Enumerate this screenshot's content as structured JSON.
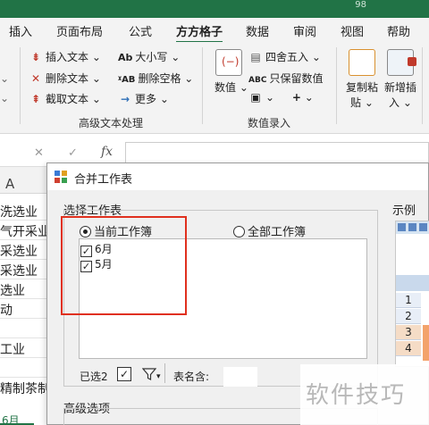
{
  "titlebar": {
    "controls_text": "98"
  },
  "ribbon_tabs": [
    "插入",
    "页面布局",
    "公式",
    "方方格子",
    "数据",
    "审阅",
    "视图",
    "帮助"
  ],
  "active_tab": "方方格子",
  "ribbon": {
    "advanced_text": {
      "insert_text": "插入文本",
      "delete_text": "删除文本",
      "extract_text": "截取文本",
      "case": "大小写",
      "remove_space": "删除空格",
      "more": "更多",
      "group_label": "高级文本处理"
    },
    "number_entry": {
      "number_btn": "数值",
      "round": "四舍五入",
      "keep_numbers": "只保留数值",
      "group_label": "数值录入"
    },
    "right_buttons": {
      "copy_paste_line1": "复制粘",
      "copy_paste_line2": "贴",
      "add_insert_line1": "新增插",
      "add_insert_line2": "入"
    }
  },
  "formula_bar": {
    "fx": "fx"
  },
  "sheet": {
    "column": "A",
    "cells": [
      "洗选业",
      "气开采业",
      "采选业",
      "采选业",
      "选业",
      "动",
      "",
      "工业",
      "",
      "精制茶制"
    ],
    "tab": "6月"
  },
  "dialog": {
    "title": "合并工作表",
    "select_section": "选择工作表",
    "example_label": "示例",
    "radio_current": "当前工作簿",
    "radio_all": "全部工作簿",
    "sheets": [
      {
        "name": "6月",
        "checked": true
      },
      {
        "name": "5月",
        "checked": true
      }
    ],
    "selected_label": "已选2",
    "filter_label": "表名含:",
    "advanced_section": "高级选项"
  },
  "example": {
    "rows": [
      "1",
      "2",
      "3",
      "4"
    ]
  },
  "watermark": "软件技巧",
  "colors": {
    "accent": "#217346",
    "highlight_border": "#e0301e"
  }
}
